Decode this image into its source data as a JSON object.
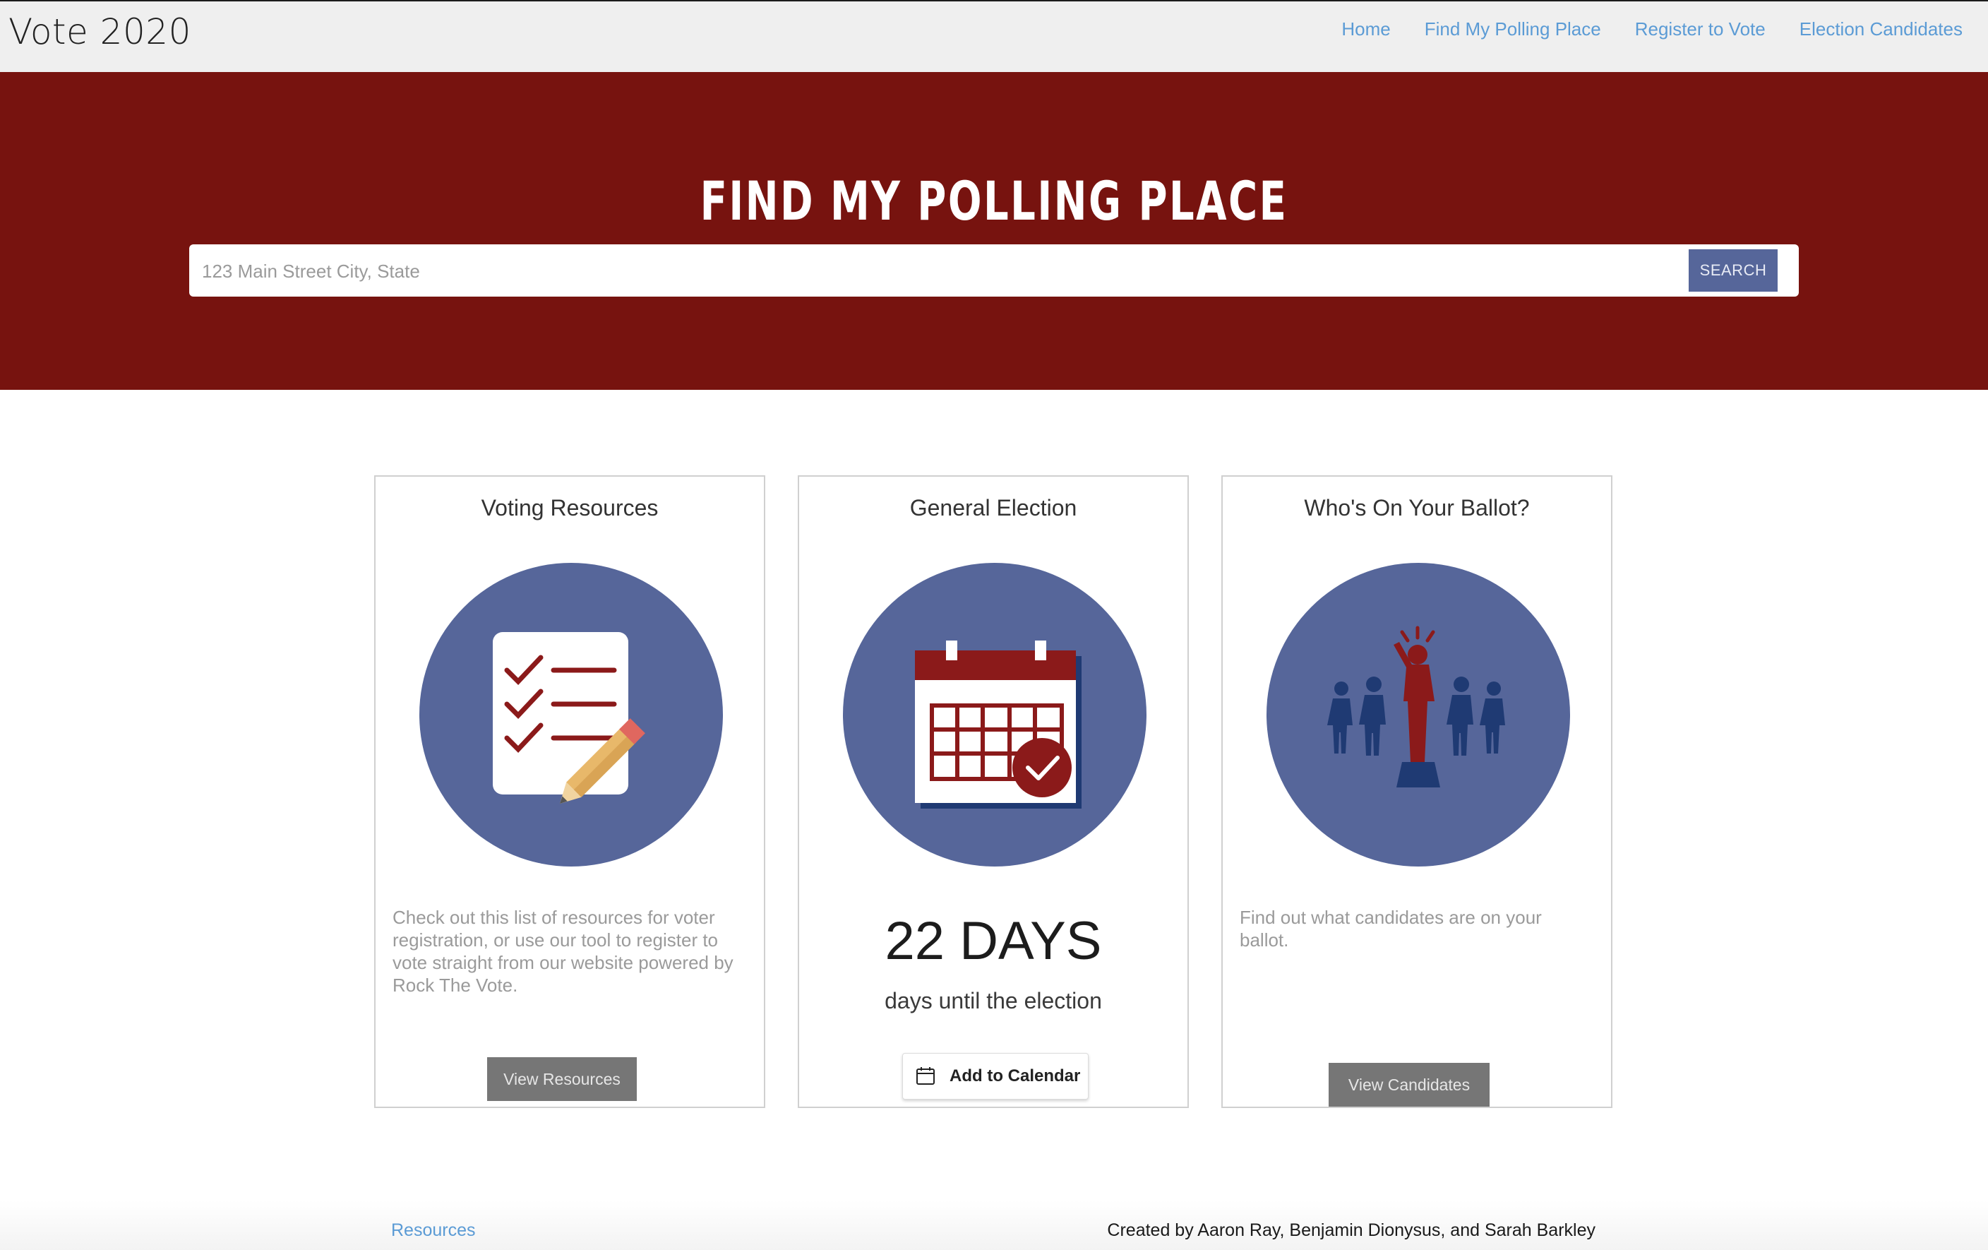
{
  "brand": "Vote 2020",
  "nav": {
    "items": [
      {
        "label": "Home"
      },
      {
        "label": "Find My Polling Place"
      },
      {
        "label": "Register to Vote"
      },
      {
        "label": "Election Candidates"
      }
    ]
  },
  "hero": {
    "title": "FIND MY POLLING PLACE",
    "search_placeholder": "123 Main Street City, State",
    "search_button": "SEARCH",
    "background": "#77130f"
  },
  "cards": {
    "resources": {
      "title": "Voting Resources",
      "icon": "checklist-pencil-icon",
      "description": "Check out this list of resources for voter registration, or use our tool to register to vote straight from our website powered by Rock The Vote.",
      "button": "View Resources"
    },
    "election": {
      "title": "General Election",
      "icon": "calendar-check-icon",
      "days_value": "22 DAYS",
      "days_label": "days until the election",
      "button": "Add to Calendar"
    },
    "ballot": {
      "title": "Who's On Your Ballot?",
      "icon": "candidate-crowd-icon",
      "description": "Find out what candidates are on your ballot.",
      "button": "View Candidates"
    }
  },
  "footer": {
    "link": "Resources",
    "credit": "Created by Aaron Ray, Benjamin Dionysus, and Sarah Barkley"
  },
  "colors": {
    "accent_red": "#77130f",
    "accent_blue": "#56669a",
    "link_blue": "#5b9bd5",
    "icon_red": "#8b1a1a",
    "icon_navy": "#1f3a73"
  }
}
